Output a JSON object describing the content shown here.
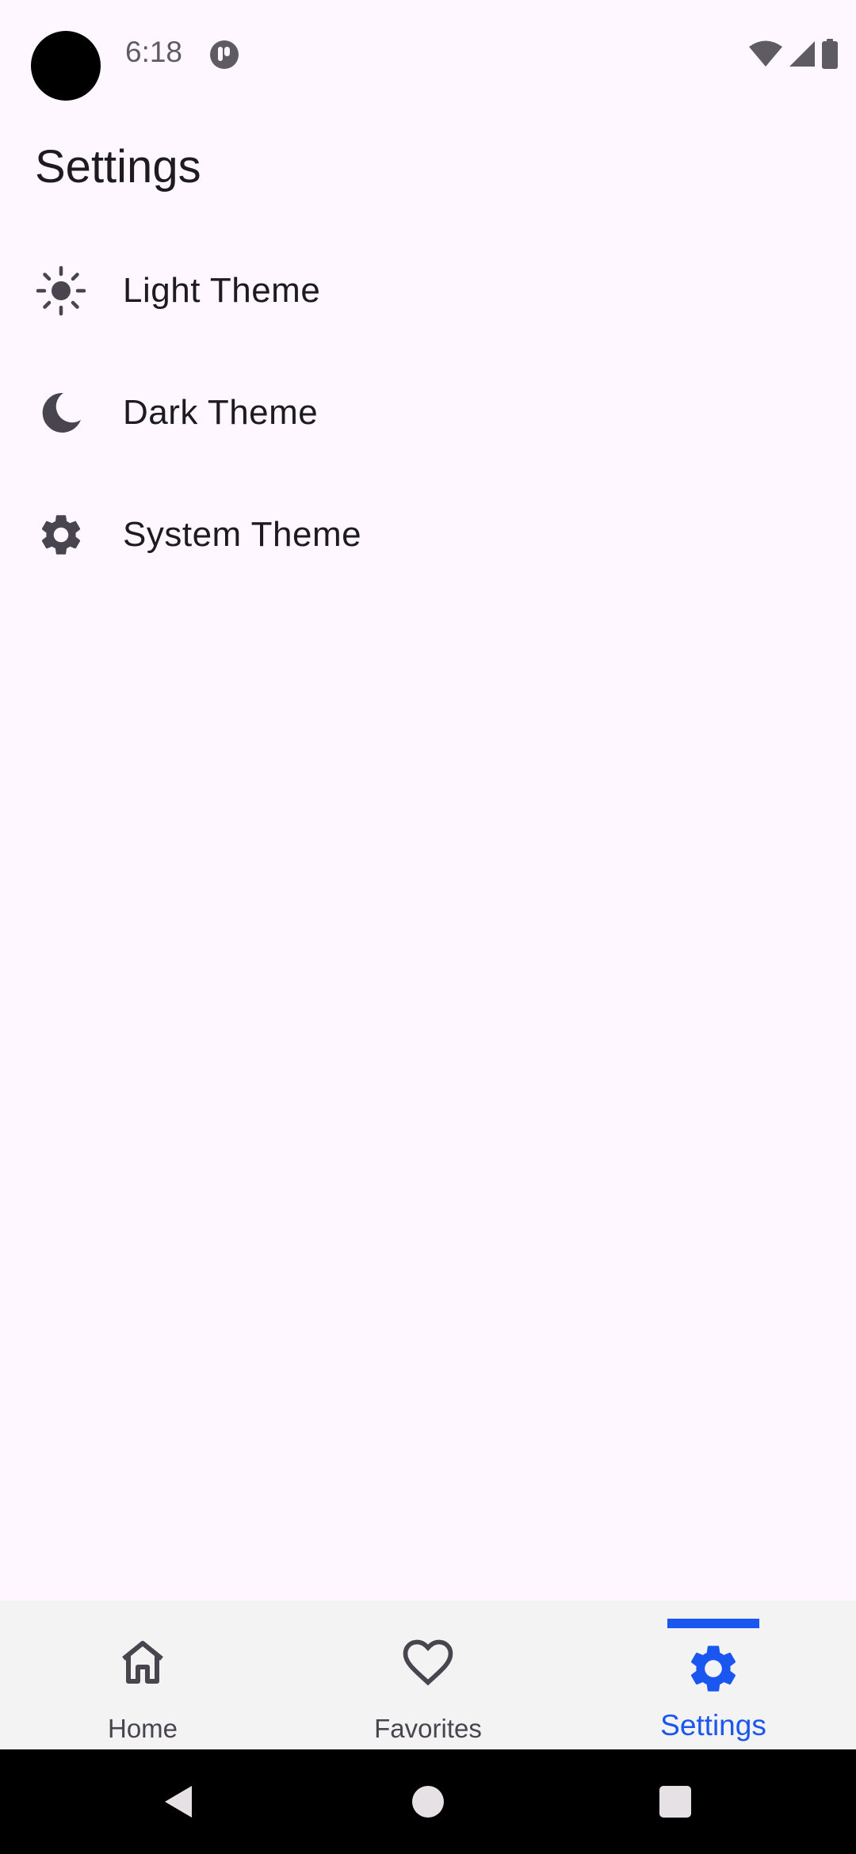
{
  "status_bar": {
    "time": "6:18",
    "icons": [
      "camera-cutout",
      "notification-app-icon",
      "wifi-icon",
      "cellular-signal-icon",
      "battery-icon"
    ]
  },
  "page": {
    "title": "Settings"
  },
  "theme_options": [
    {
      "label": "Light Theme",
      "icon": "sun-icon"
    },
    {
      "label": "Dark Theme",
      "icon": "moon-icon"
    },
    {
      "label": "System Theme",
      "icon": "gear-icon"
    }
  ],
  "bottom_nav": {
    "items": [
      {
        "label": "Home",
        "icon": "home-icon",
        "active": false
      },
      {
        "label": "Favorites",
        "icon": "heart-icon",
        "active": false
      },
      {
        "label": "Settings",
        "icon": "gear-icon",
        "active": true
      }
    ]
  },
  "system_nav": {
    "buttons": [
      "back-icon",
      "home-circle-icon",
      "recents-icon"
    ]
  },
  "colors": {
    "background": "#FEF7FF",
    "text_primary": "#1D1B20",
    "icon": "#49454F",
    "accent": "#1A56F0",
    "nav_background": "#F3F3F3",
    "system_bar": "#000000"
  }
}
